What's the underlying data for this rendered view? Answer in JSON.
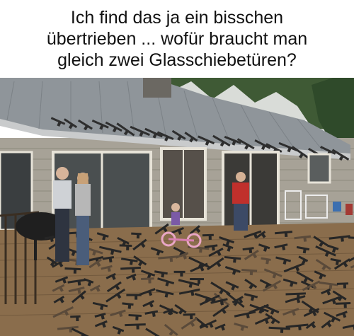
{
  "caption": {
    "lines": [
      "Ich find das ja ein bisschen",
      "übertrieben ... wofür braucht man",
      "gleich zwei Glasschiebetüren?"
    ]
  },
  "photo": {
    "subject": "meme-photo",
    "colors": {
      "sky": "#d9dcd8",
      "trees": "#3f5a35",
      "roof": "#8f959a",
      "wall": "#a7a297",
      "deck": "#8a6d4c",
      "guns": "#2a2a2a",
      "shirt_red": "#c0302c"
    }
  }
}
